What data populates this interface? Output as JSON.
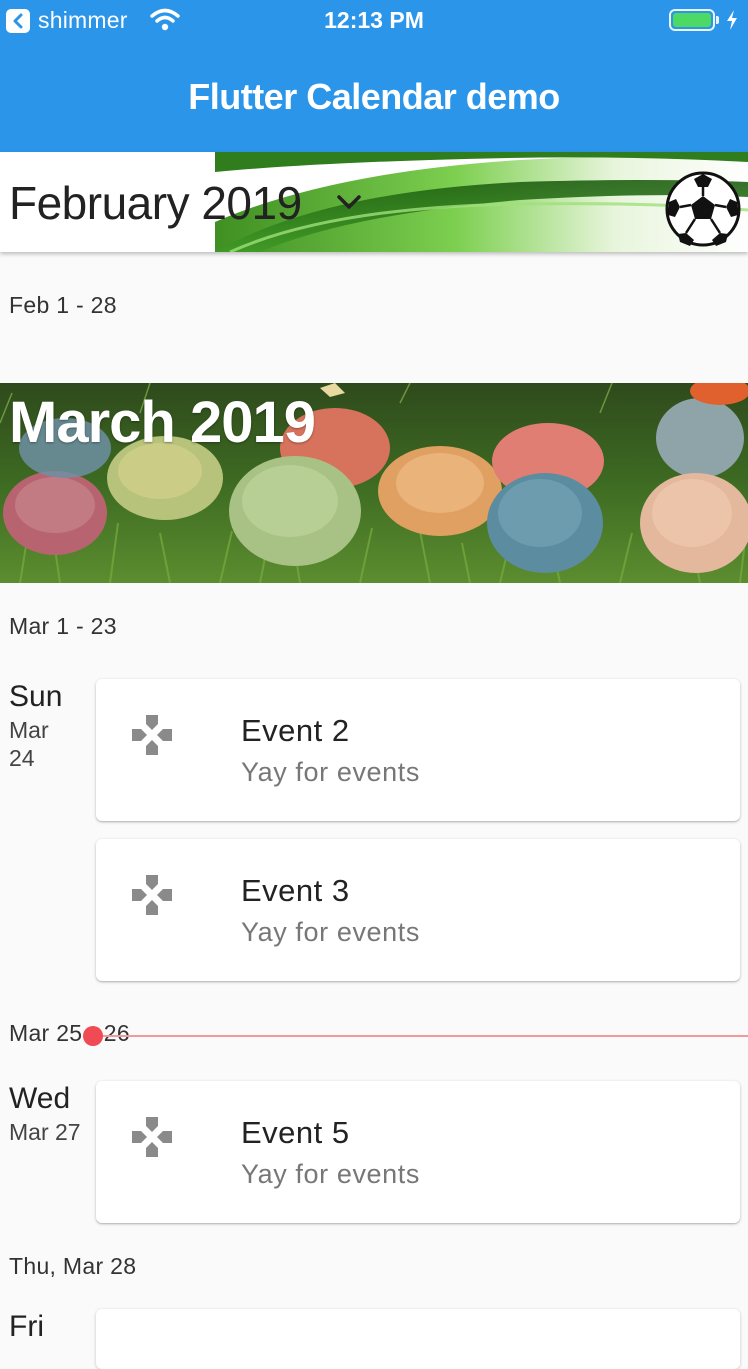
{
  "status_bar": {
    "back_app": "shimmer",
    "time": "12:13 PM",
    "battery_level": 1.0,
    "icons": [
      "back-arrow-icon",
      "wifi-icon",
      "battery-icon",
      "charging-bolt-icon"
    ]
  },
  "app_bar": {
    "title": "Flutter Calendar demo"
  },
  "current_month": {
    "label": "February 2019",
    "dropdown_icon": "chevron-down-icon",
    "banner_icon": "soccer-ball-icon"
  },
  "sections": {
    "feb_range": "Feb 1 - 28",
    "march_banner": "March 2019",
    "mar_range": "Mar 1 - 23",
    "now_range": "Mar 25 - 26",
    "thu_label": "Thu, Mar 28"
  },
  "days": [
    {
      "weekday": "Sun",
      "date_line1": "Mar",
      "date_line2": "24",
      "events": [
        {
          "title": "Event 2",
          "subtitle": "Yay for events",
          "icon": "gamepad-icon"
        },
        {
          "title": "Event 3",
          "subtitle": "Yay for events",
          "icon": "gamepad-icon"
        }
      ]
    },
    {
      "weekday": "Wed",
      "date_line1": "Mar 27",
      "events": [
        {
          "title": "Event 5",
          "subtitle": "Yay for events",
          "icon": "gamepad-icon"
        }
      ]
    },
    {
      "weekday": "Fri"
    }
  ],
  "colors": {
    "primary": "#2b95e9",
    "now_indicator": "#f04a54",
    "background": "#fafafa"
  }
}
